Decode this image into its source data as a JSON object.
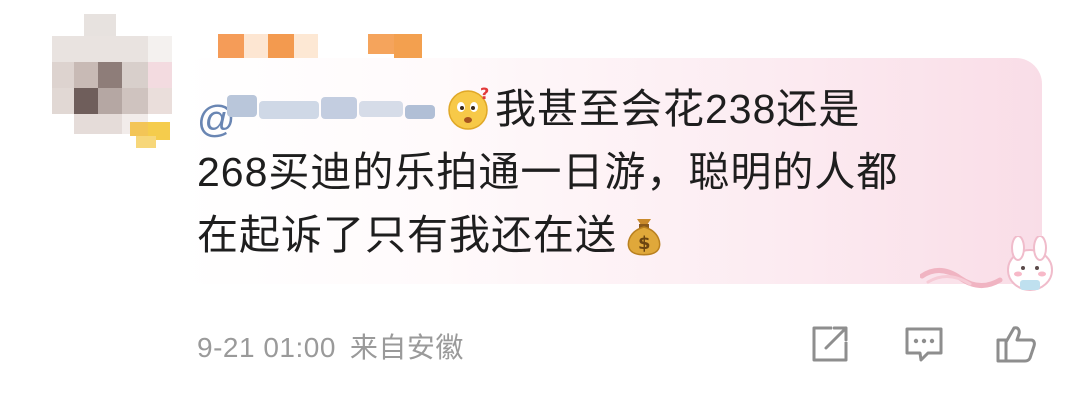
{
  "comment": {
    "text_line1": "我甚至会花238还是",
    "text_line2": "268买迪的乐拍通一日游，聪明的人都",
    "text_line3": "在起诉了只有我还在送",
    "mention_symbol": "@",
    "emoji_start": "confused-face-icon",
    "emoji_end": "money-bag-icon"
  },
  "meta": {
    "date": "9-21 01:00",
    "location": "来自安徽"
  },
  "actions": [
    {
      "name": "share",
      "icon": "share-icon"
    },
    {
      "name": "comment",
      "icon": "comment-icon"
    },
    {
      "name": "like",
      "icon": "thumbs-up-icon"
    }
  ],
  "colors": {
    "text": "#1e1e1e",
    "meta": "#9a9a9a",
    "mention": "#6a86b3",
    "bubble_tint": "#f9dde7"
  }
}
